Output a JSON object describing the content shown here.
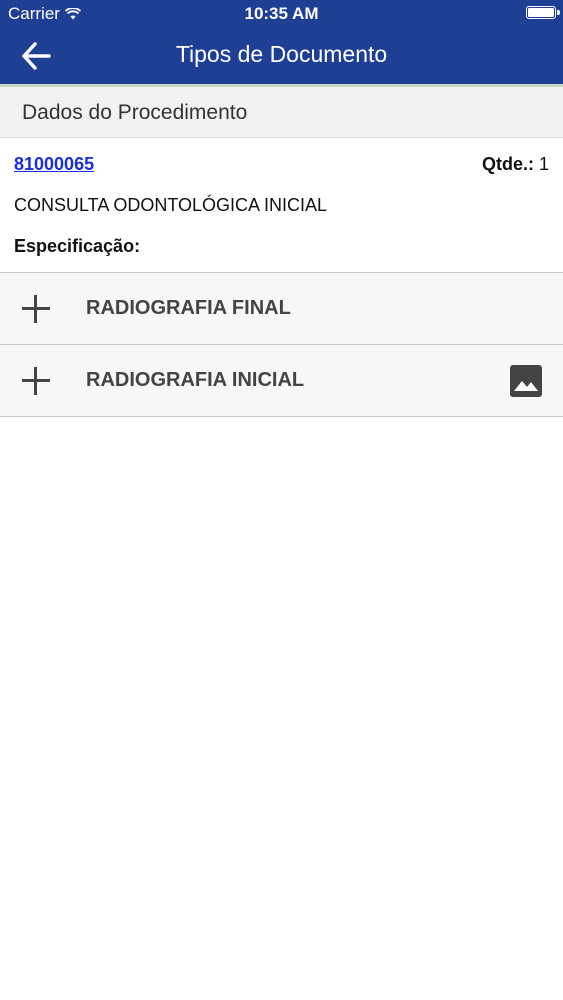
{
  "status_bar": {
    "carrier": "Carrier",
    "time": "10:35 AM",
    "icons": [
      "wifi-icon",
      "battery-icon"
    ]
  },
  "header": {
    "title": "Tipos de Documento",
    "back_icon": "arrow-left-icon",
    "background_color": "#1f3f94"
  },
  "section": {
    "title": "Dados do Procedimento"
  },
  "procedure": {
    "code": "81000065",
    "qty_label": "Qtde.:",
    "qty_value": "1",
    "description": "CONSULTA ODONTOLÓGICA INICIAL",
    "spec_label": "Especificação:"
  },
  "document_types": [
    {
      "label": "RADIOGRAFIA FINAL",
      "icon": "plus-icon",
      "has_image": false
    },
    {
      "label": "RADIOGRAFIA INICIAL",
      "icon": "plus-icon",
      "has_image": true,
      "image_icon": "image-icon"
    }
  ],
  "colors": {
    "link": "#1a2fd6",
    "row_text": "#444444"
  }
}
